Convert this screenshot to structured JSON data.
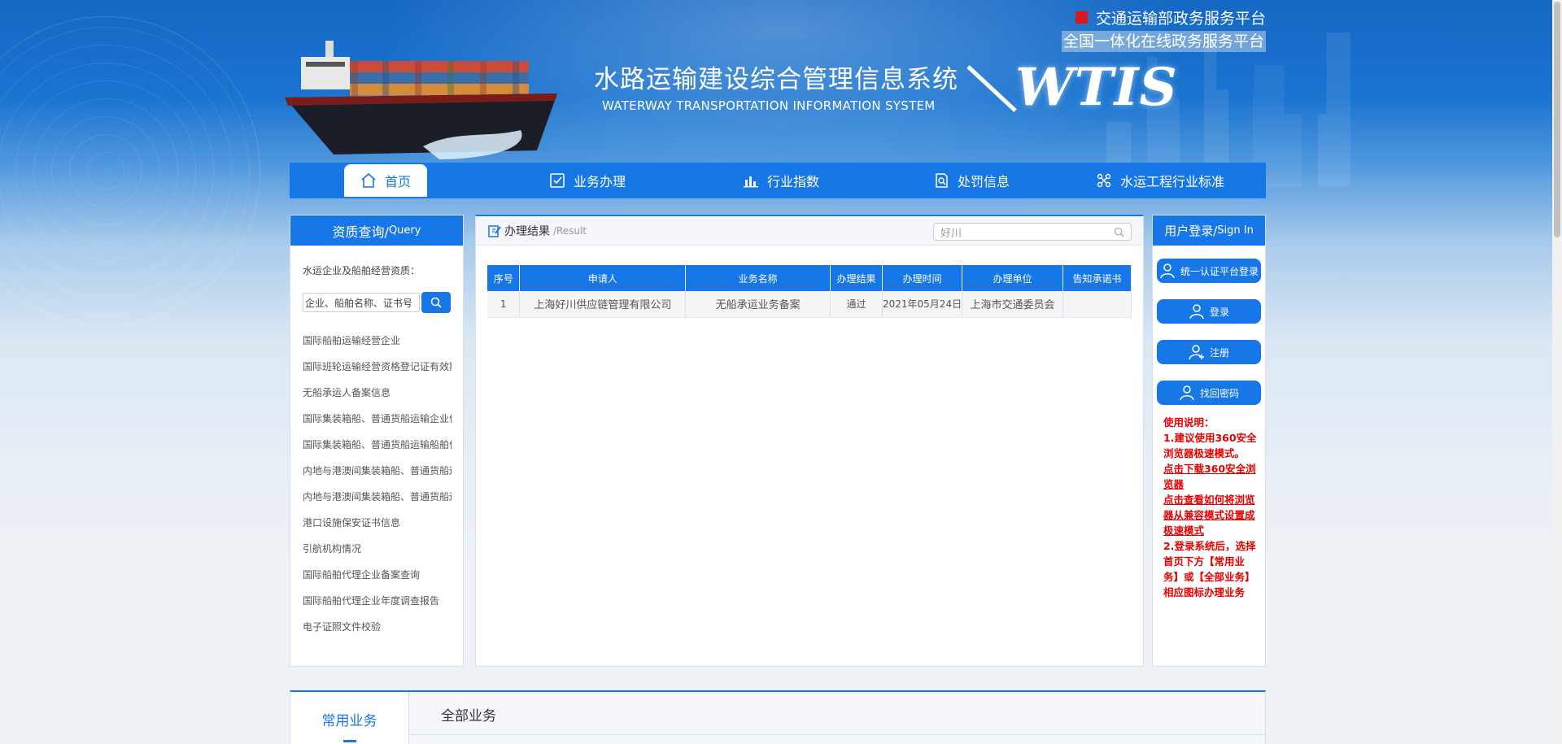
{
  "header": {
    "system_title": "水路运输建设综合管理信息系统",
    "system_subtitle": "WATERWAY TRANSPORTATION INFORMATION SYSTEM",
    "logo_text": "WTIS",
    "top_link_1": "交通运输部政务服务平台",
    "top_link_2": "全国一体化在线政务服务平台"
  },
  "nav": {
    "items": [
      {
        "label": "首页",
        "icon": "home-icon"
      },
      {
        "label": "业务办理",
        "icon": "checklist-icon"
      },
      {
        "label": "行业指数",
        "icon": "bar-chart-icon"
      },
      {
        "label": "处罚信息",
        "icon": "document-search-icon"
      },
      {
        "label": "水运工程行业标准",
        "icon": "network-icon"
      }
    ]
  },
  "query": {
    "title": "资质查询/",
    "title_en": "Query",
    "label": "水运企业及船舶经营资质：",
    "search_placeholder": "企业、船舶名称、证书号（",
    "items": [
      "国际船舶运输经营企业",
      "国际班轮运输经营资格登记证有效期",
      "无船承运人备案信息",
      "国际集装箱船、普通货船运输企业信息",
      "国际集装箱船、普通货船运输船舶信息",
      "内地与港澳间集装箱船、普通货船运输企业",
      "内地与港澳间集装箱船、普通货船运输船舶",
      "港口设施保安证书信息",
      "引航机构情况",
      "国际船舶代理企业备案查询",
      "国际船舶代理企业年度调查报告",
      "电子证照文件校验"
    ]
  },
  "result": {
    "title": "办理结果",
    "title_en": "/Result",
    "search_value": "好川",
    "columns": [
      "序号",
      "申请人",
      "业务名称",
      "办理结果",
      "办理时间",
      "办理单位",
      "告知承诺书"
    ],
    "rows": [
      [
        "1",
        "上海好川供应链管理有限公司",
        "无船承运业务备案",
        "通过",
        "2021年05月24日",
        "上海市交通委员会",
        ""
      ]
    ]
  },
  "login": {
    "title": "用户登录/",
    "title_en": "Sign In",
    "buttons": [
      "统一认证平台登录",
      "登录",
      "注册",
      "找回密码"
    ],
    "notes": {
      "heading": "使用说明：",
      "line1": "1.建议使用360安全浏览器极速模式。",
      "link1": "点击下载360安全浏览器",
      "link2": "点击查看如何将浏览器从兼容模式设置成极速模式",
      "line2": "2.登录系统后，选择首页下方【常用业务】或【全部业务】相应图标办理业务"
    }
  },
  "bottom_tabs": [
    "常用业务",
    "全部业务"
  ],
  "colors": {
    "primary": "#1777e6",
    "notice_red": "#e60000"
  }
}
